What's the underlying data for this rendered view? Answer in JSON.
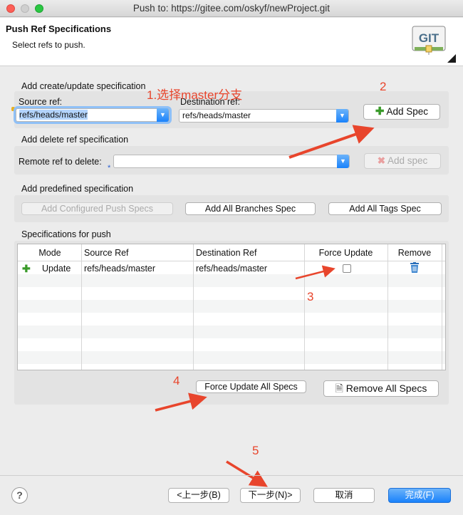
{
  "window": {
    "title": "Push to: https://gitee.com/oskyf/newProject.git"
  },
  "header": {
    "title": "Push Ref Specifications",
    "subtitle": "Select refs to push.",
    "logo_text": "GIT"
  },
  "create_section": {
    "heading": "Add create/update specification",
    "source_label": "Source ref:",
    "source_value": "refs/heads/master",
    "dest_label": "Destination ref:",
    "dest_value": "refs/heads/master",
    "add_button": "Add Spec"
  },
  "delete_section": {
    "heading": "Add delete ref specification",
    "remote_label": "Remote ref to delete:",
    "remote_value": "",
    "add_button": "Add spec"
  },
  "predefined_section": {
    "heading": "Add predefined specification",
    "configured_button": "Add Configured Push Specs",
    "branches_button": "Add All Branches Spec",
    "tags_button": "Add All Tags Spec"
  },
  "specs_section": {
    "heading": "Specifications for push",
    "columns": [
      "Mode",
      "Source Ref",
      "Destination Ref",
      "Force Update",
      "Remove"
    ],
    "rows": [
      {
        "mode": "Update",
        "source": "refs/heads/master",
        "destination": "refs/heads/master",
        "force": false
      }
    ],
    "force_all_button": "Force Update All Specs",
    "remove_all_button": "Remove All Specs"
  },
  "annotations": {
    "a1": "1.选择master分支",
    "a2": "2",
    "a3": "3",
    "a4": "4",
    "a5": "5"
  },
  "footer": {
    "back": "<上一步(B)",
    "next": "下一步(N)>",
    "cancel": "取消",
    "finish": "完成(F)"
  },
  "colors": {
    "annotation": "#e8452c",
    "accent": "#1a82fb"
  }
}
